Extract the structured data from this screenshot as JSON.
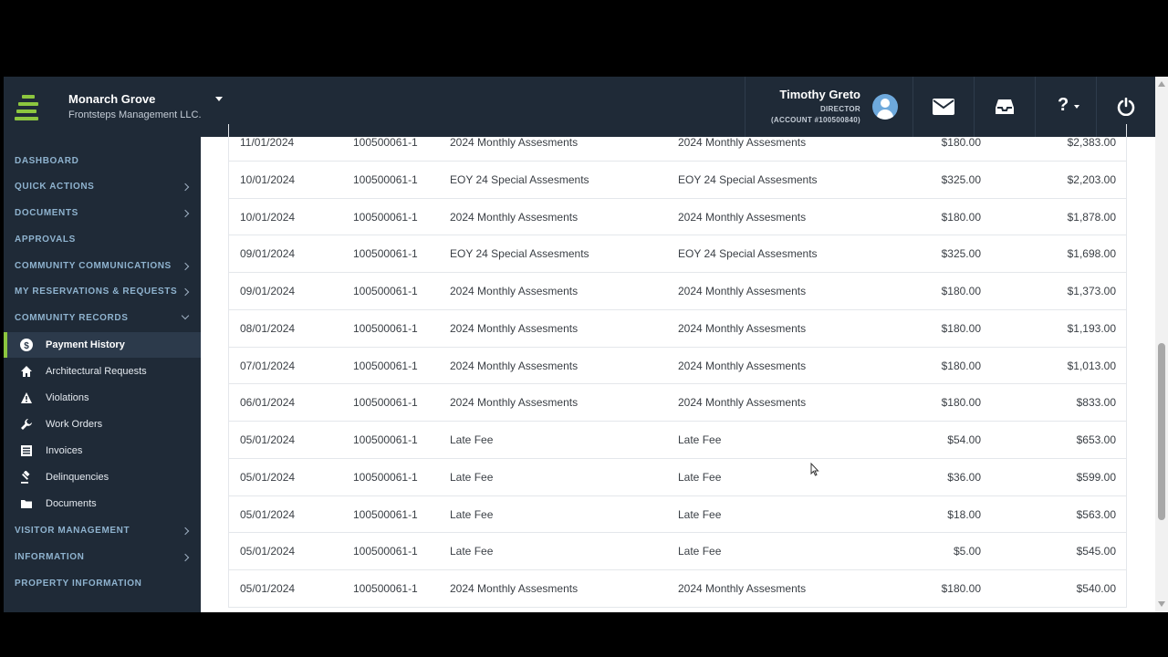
{
  "header": {
    "org_name": "Monarch Grove",
    "org_subtitle": "Frontsteps Management LLC.",
    "user_name": "Timothy Greto",
    "user_role": "DIRECTOR",
    "user_account": "(ACCOUNT #100500840)",
    "help_label": "?",
    "accent_color": "#8cc63f",
    "bg_color": "#1f2a37"
  },
  "sidebar": {
    "sections": [
      {
        "label": "DASHBOARD"
      },
      {
        "label": "QUICK ACTIONS"
      },
      {
        "label": "DOCUMENTS"
      },
      {
        "label": "APPROVALS"
      },
      {
        "label": "COMMUNITY COMMUNICATIONS"
      },
      {
        "label": "MY RESERVATIONS & REQUESTS"
      },
      {
        "label": "COMMUNITY RECORDS"
      },
      {
        "label": "VISITOR MANAGEMENT"
      },
      {
        "label": "INFORMATION"
      },
      {
        "label": "PROPERTY INFORMATION"
      }
    ],
    "community_records_items": [
      {
        "label": "Payment History",
        "icon": "dollar-icon",
        "active": true
      },
      {
        "label": "Architectural Requests",
        "icon": "home-icon"
      },
      {
        "label": "Violations",
        "icon": "warning-icon"
      },
      {
        "label": "Work Orders",
        "icon": "wrench-icon"
      },
      {
        "label": "Invoices",
        "icon": "invoice-icon"
      },
      {
        "label": "Delinquencies",
        "icon": "gavel-icon"
      },
      {
        "label": "Documents",
        "icon": "folder-icon"
      }
    ]
  },
  "table": {
    "rows": [
      {
        "date": "11/01/2024",
        "account": "100500061-1",
        "description": "2024 Monthly Assesments",
        "memo": "2024 Monthly Assesments",
        "amount": "$180.00",
        "balance": "$2,383.00"
      },
      {
        "date": "10/01/2024",
        "account": "100500061-1",
        "description": "EOY 24 Special Assesments",
        "memo": "EOY 24 Special Assesments",
        "amount": "$325.00",
        "balance": "$2,203.00"
      },
      {
        "date": "10/01/2024",
        "account": "100500061-1",
        "description": "2024 Monthly Assesments",
        "memo": "2024 Monthly Assesments",
        "amount": "$180.00",
        "balance": "$1,878.00"
      },
      {
        "date": "09/01/2024",
        "account": "100500061-1",
        "description": "EOY 24 Special Assesments",
        "memo": "EOY 24 Special Assesments",
        "amount": "$325.00",
        "balance": "$1,698.00"
      },
      {
        "date": "09/01/2024",
        "account": "100500061-1",
        "description": "2024 Monthly Assesments",
        "memo": "2024 Monthly Assesments",
        "amount": "$180.00",
        "balance": "$1,373.00"
      },
      {
        "date": "08/01/2024",
        "account": "100500061-1",
        "description": "2024 Monthly Assesments",
        "memo": "2024 Monthly Assesments",
        "amount": "$180.00",
        "balance": "$1,193.00"
      },
      {
        "date": "07/01/2024",
        "account": "100500061-1",
        "description": "2024 Monthly Assesments",
        "memo": "2024 Monthly Assesments",
        "amount": "$180.00",
        "balance": "$1,013.00"
      },
      {
        "date": "06/01/2024",
        "account": "100500061-1",
        "description": "2024 Monthly Assesments",
        "memo": "2024 Monthly Assesments",
        "amount": "$180.00",
        "balance": "$833.00"
      },
      {
        "date": "05/01/2024",
        "account": "100500061-1",
        "description": "Late Fee",
        "memo": "Late Fee",
        "amount": "$54.00",
        "balance": "$653.00"
      },
      {
        "date": "05/01/2024",
        "account": "100500061-1",
        "description": "Late Fee",
        "memo": "Late Fee",
        "amount": "$36.00",
        "balance": "$599.00"
      },
      {
        "date": "05/01/2024",
        "account": "100500061-1",
        "description": "Late Fee",
        "memo": "Late Fee",
        "amount": "$18.00",
        "balance": "$563.00"
      },
      {
        "date": "05/01/2024",
        "account": "100500061-1",
        "description": "Late Fee",
        "memo": "Late Fee",
        "amount": "$5.00",
        "balance": "$545.00"
      },
      {
        "date": "05/01/2024",
        "account": "100500061-1",
        "description": "2024 Monthly Assesments",
        "memo": "2024 Monthly Assesments",
        "amount": "$180.00",
        "balance": "$540.00"
      }
    ]
  }
}
